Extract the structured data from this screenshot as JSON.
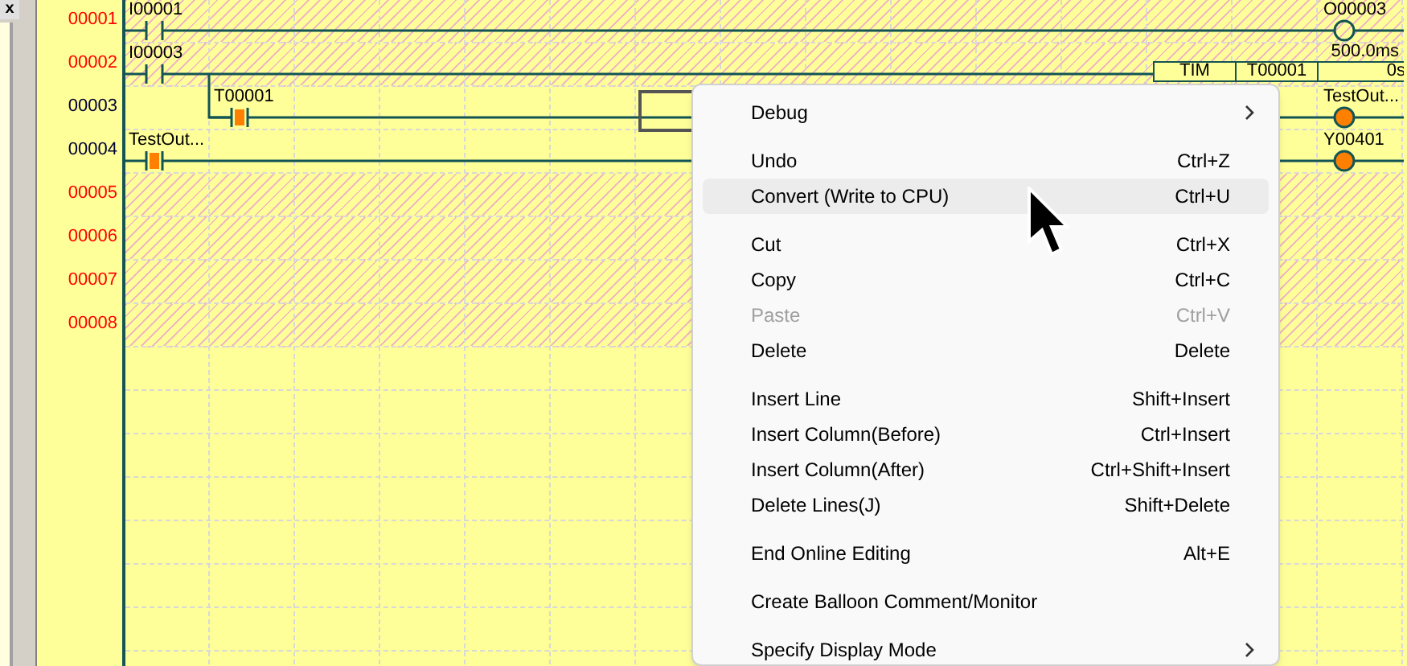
{
  "side_panel": {
    "close": "x"
  },
  "rows": [
    {
      "number": "00001",
      "editable": false,
      "cursor": false,
      "branch_from_above": false,
      "contact": {
        "label": "I00001",
        "energized": false
      },
      "output": {
        "kind": "coil",
        "label": "O00003",
        "energized": false
      }
    },
    {
      "number": "00002",
      "editable": false,
      "cursor": false,
      "branch_from_above": false,
      "contact": {
        "label": "I00003",
        "energized": false
      },
      "output": {
        "kind": "timer",
        "instruction": "TIM",
        "operand": "T00001",
        "value": "0s",
        "setting": "500.0ms"
      }
    },
    {
      "number": "00003",
      "editable": true,
      "cursor": true,
      "branch_from_above": true,
      "contact": {
        "label": "T00001",
        "energized": true
      },
      "output": {
        "kind": "coil",
        "label": "TestOut...",
        "energized": true
      }
    },
    {
      "number": "00004",
      "editable": true,
      "cursor": false,
      "branch_from_above": false,
      "contact": {
        "label": "TestOut...",
        "energized": true
      },
      "output": {
        "kind": "coil",
        "label": "Y00401",
        "energized": true
      }
    },
    {
      "number": "00005",
      "editable": false,
      "cursor": false,
      "branch_from_above": false
    },
    {
      "number": "00006",
      "editable": false,
      "cursor": false,
      "branch_from_above": false
    },
    {
      "number": "00007",
      "editable": false,
      "cursor": false,
      "branch_from_above": false
    },
    {
      "number": "00008",
      "editable": false,
      "cursor": false,
      "branch_from_above": false
    }
  ],
  "context_menu": [
    {
      "kind": "item",
      "label": "Debug",
      "submenu": true,
      "selected": false,
      "disabled": false
    },
    {
      "kind": "separator"
    },
    {
      "kind": "item",
      "label": "Undo",
      "shortcut": "Ctrl+Z",
      "selected": false,
      "disabled": false
    },
    {
      "kind": "item",
      "label": "Convert (Write to CPU)",
      "shortcut": "Ctrl+U",
      "selected": true,
      "disabled": false
    },
    {
      "kind": "separator"
    },
    {
      "kind": "item",
      "label": "Cut",
      "shortcut": "Ctrl+X",
      "selected": false,
      "disabled": false
    },
    {
      "kind": "item",
      "label": "Copy",
      "shortcut": "Ctrl+C",
      "selected": false,
      "disabled": false
    },
    {
      "kind": "item",
      "label": "Paste",
      "shortcut": "Ctrl+V",
      "selected": false,
      "disabled": true
    },
    {
      "kind": "item",
      "label": "Delete",
      "shortcut": "Delete",
      "selected": false,
      "disabled": false
    },
    {
      "kind": "separator"
    },
    {
      "kind": "item",
      "label": "Insert Line",
      "shortcut": "Shift+Insert",
      "selected": false,
      "disabled": false
    },
    {
      "kind": "item",
      "label": "Insert Column(Before)",
      "shortcut": "Ctrl+Insert",
      "selected": false,
      "disabled": false
    },
    {
      "kind": "item",
      "label": "Insert Column(After)",
      "shortcut": "Ctrl+Shift+Insert",
      "selected": false,
      "disabled": false
    },
    {
      "kind": "item",
      "label": "Delete Lines(J)",
      "shortcut": "Shift+Delete",
      "selected": false,
      "disabled": false
    },
    {
      "kind": "separator"
    },
    {
      "kind": "item",
      "label": "End Online Editing",
      "shortcut": "Alt+E",
      "selected": false,
      "disabled": false
    },
    {
      "kind": "separator"
    },
    {
      "kind": "item",
      "label": "Create Balloon Comment/Monitor",
      "selected": false,
      "disabled": false
    },
    {
      "kind": "separator"
    },
    {
      "kind": "item",
      "label": "Specify Display Mode",
      "submenu": true,
      "selected": false,
      "disabled": false
    }
  ]
}
